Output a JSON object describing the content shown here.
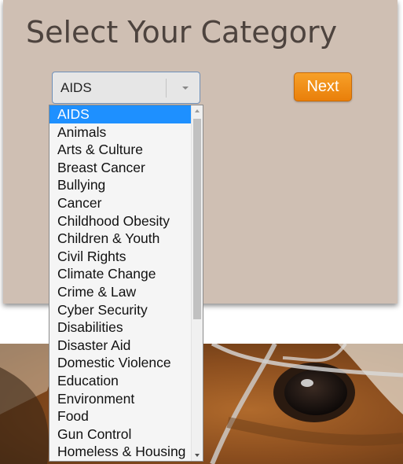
{
  "page": {
    "title": "Select Your Category",
    "next_label": "Next"
  },
  "select": {
    "value": "AIDS"
  },
  "dropdown": {
    "scroll_position": 0.0,
    "options": [
      "AIDS",
      "Animals",
      "Arts & Culture",
      "Breast Cancer",
      "Bullying",
      "Cancer",
      "Childhood Obesity",
      "Children & Youth",
      "Civil Rights",
      "Climate Change",
      "Crime & Law",
      "Cyber Security",
      "Disabilities",
      "Disaster Aid",
      "Domestic Violence",
      "Education",
      "Environment",
      "Food",
      "Gun Control",
      "Homeless & Housing"
    ],
    "selected_index": 0
  },
  "colors": {
    "panel_background": "#cfbfb3",
    "title_text": "#4d433e",
    "next_button": "#f39520",
    "selected_option": "#1e90ff"
  },
  "photo": {
    "subject": "close-up of a dog's eye behind a chain-link fence"
  }
}
